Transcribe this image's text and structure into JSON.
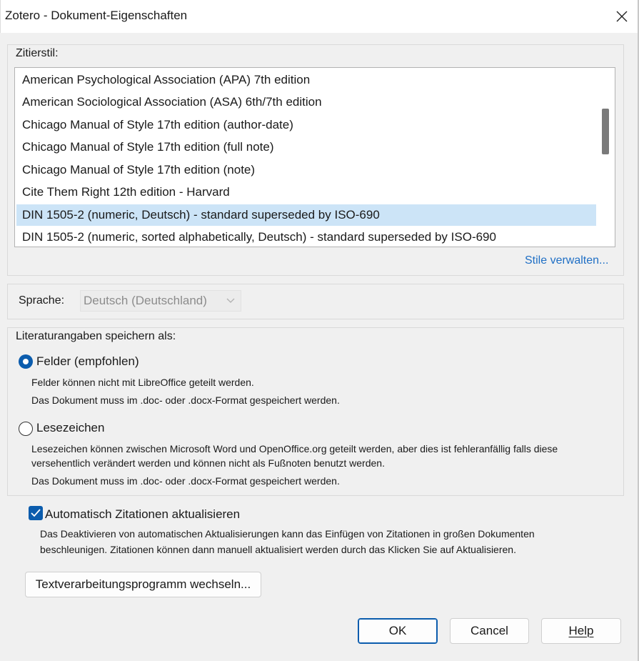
{
  "window": {
    "title": "Zotero - Dokument-Eigenschaften"
  },
  "citation_style": {
    "label": "Zitierstil:",
    "items": [
      "American Psychological Association (APA) 7th edition",
      "American Sociological Association (ASA) 6th/7th edition",
      "Chicago Manual of Style 17th edition (author-date)",
      "Chicago Manual of Style 17th edition (full note)",
      "Chicago Manual of Style 17th edition (note)",
      "Cite Them Right 12th edition - Harvard",
      "DIN 1505-2 (numeric, Deutsch) - standard superseded by ISO-690",
      "DIN 1505-2 (numeric, sorted alphabetically, Deutsch) - standard superseded by ISO-690"
    ],
    "selected_index": 6,
    "manage_link": "Stile verwalten..."
  },
  "language": {
    "label": "Sprache:",
    "value": "Deutsch (Deutschland)"
  },
  "storage": {
    "label": "Literaturangaben speichern als:",
    "fields_option": {
      "label": "Felder (empfohlen)",
      "selected": true,
      "note1": "Felder können nicht mit LibreOffice geteilt werden.",
      "note2": "Das Dokument muss im .doc- oder .docx-Format gespeichert werden."
    },
    "bookmarks_option": {
      "label": "Lesezeichen",
      "selected": false,
      "note1": "Lesezeichen können zwischen Microsoft Word und OpenOffice.org geteilt werden, aber dies ist fehleranfällig falls diese",
      "note2": "versehentlich verändert werden und können nicht als Fußnoten benutzt werden.",
      "note3": "Das Dokument muss im .doc- oder .docx-Format gespeichert werden."
    }
  },
  "auto_update": {
    "label": "Automatisch Zitationen aktualisieren",
    "checked": true,
    "note1": "Das Deaktivieren von automatischen Aktualisierungen kann das Einfügen von Zitationen in großen Dokumenten",
    "note2": "beschleunigen. Zitationen können dann manuell aktualisiert werden durch das Klicken Sie auf Aktualisieren."
  },
  "switch_button": "Textverarbeitungsprogramm wechseln...",
  "buttons": {
    "ok": "OK",
    "cancel": "Cancel",
    "help": "Help"
  },
  "colors": {
    "accent": "#0b5cad",
    "selection": "#cce4f7",
    "link": "#1f6fc5"
  }
}
